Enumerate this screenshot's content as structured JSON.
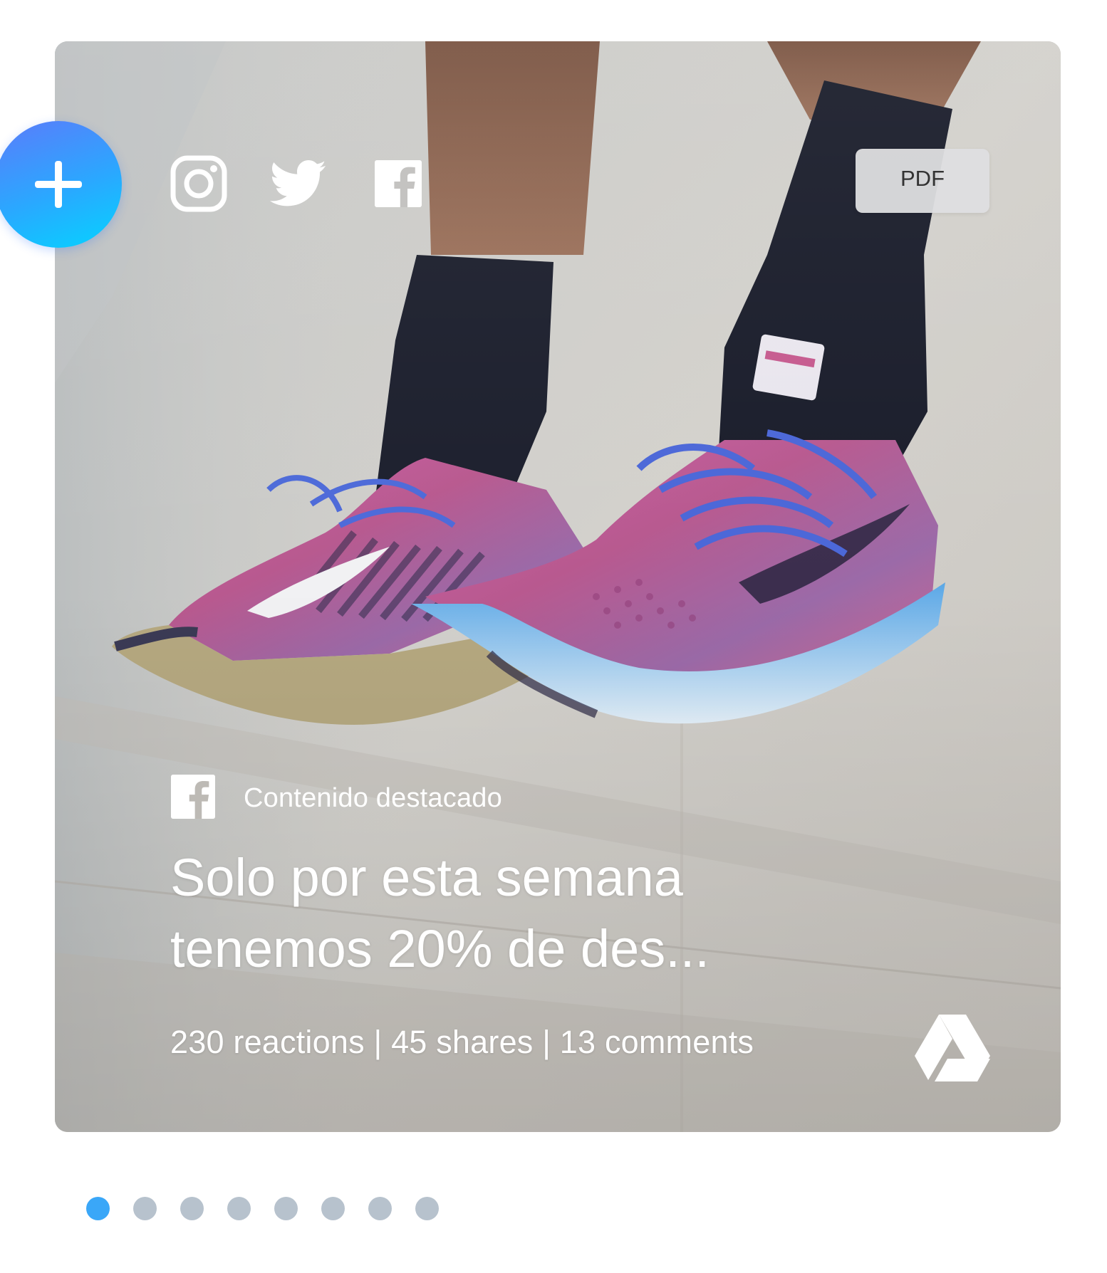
{
  "card": {
    "pdf_label": "PDF",
    "social_icons": [
      "instagram-icon",
      "twitter-icon",
      "facebook-icon"
    ],
    "featured_source_icon": "facebook-icon",
    "featured_label": "Contenido destacado",
    "title": "Solo por esta semana tenemos 20% de des...",
    "stats": "230 reactions | 45 shares | 13 comments",
    "storage_icon": "google-drive-icon"
  },
  "add_button": {
    "icon": "plus-icon",
    "gradient": [
      "#5b7cfa",
      "#2aa8ff",
      "#05d3ff"
    ]
  },
  "pagination": {
    "total": 8,
    "active_index": 0,
    "active_color": "#3aa7f8",
    "inactive_color": "#b7c2cd"
  }
}
